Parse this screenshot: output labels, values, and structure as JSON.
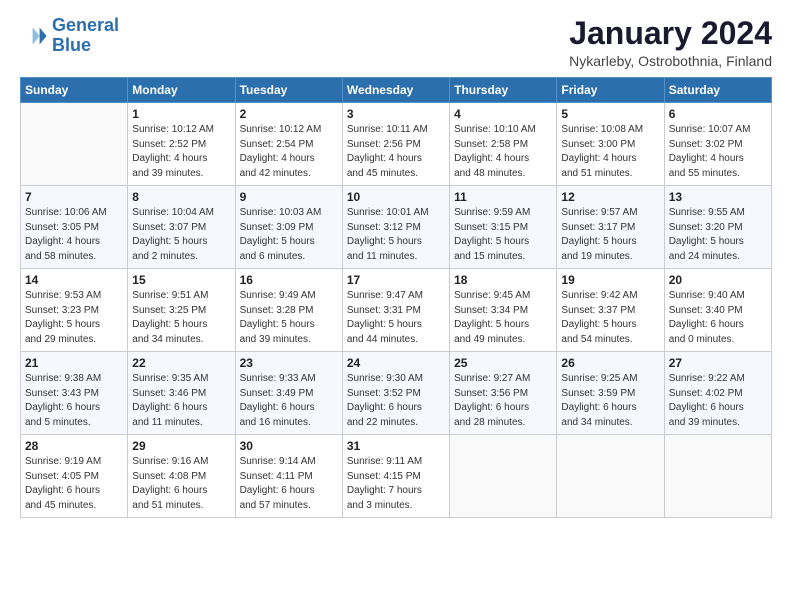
{
  "logo": {
    "line1": "General",
    "line2": "Blue"
  },
  "title": "January 2024",
  "subtitle": "Nykarleby, Ostrobothnia, Finland",
  "weekdays": [
    "Sunday",
    "Monday",
    "Tuesday",
    "Wednesday",
    "Thursday",
    "Friday",
    "Saturday"
  ],
  "weeks": [
    [
      {
        "day": "",
        "sunrise": "",
        "sunset": "",
        "daylight": ""
      },
      {
        "day": "1",
        "sunrise": "Sunrise: 10:12 AM",
        "sunset": "Sunset: 2:52 PM",
        "daylight": "Daylight: 4 hours and 39 minutes."
      },
      {
        "day": "2",
        "sunrise": "Sunrise: 10:12 AM",
        "sunset": "Sunset: 2:54 PM",
        "daylight": "Daylight: 4 hours and 42 minutes."
      },
      {
        "day": "3",
        "sunrise": "Sunrise: 10:11 AM",
        "sunset": "Sunset: 2:56 PM",
        "daylight": "Daylight: 4 hours and 45 minutes."
      },
      {
        "day": "4",
        "sunrise": "Sunrise: 10:10 AM",
        "sunset": "Sunset: 2:58 PM",
        "daylight": "Daylight: 4 hours and 48 minutes."
      },
      {
        "day": "5",
        "sunrise": "Sunrise: 10:08 AM",
        "sunset": "Sunset: 3:00 PM",
        "daylight": "Daylight: 4 hours and 51 minutes."
      },
      {
        "day": "6",
        "sunrise": "Sunrise: 10:07 AM",
        "sunset": "Sunset: 3:02 PM",
        "daylight": "Daylight: 4 hours and 55 minutes."
      }
    ],
    [
      {
        "day": "7",
        "sunrise": "Sunrise: 10:06 AM",
        "sunset": "Sunset: 3:05 PM",
        "daylight": "Daylight: 4 hours and 58 minutes."
      },
      {
        "day": "8",
        "sunrise": "Sunrise: 10:04 AM",
        "sunset": "Sunset: 3:07 PM",
        "daylight": "Daylight: 5 hours and 2 minutes."
      },
      {
        "day": "9",
        "sunrise": "Sunrise: 10:03 AM",
        "sunset": "Sunset: 3:09 PM",
        "daylight": "Daylight: 5 hours and 6 minutes."
      },
      {
        "day": "10",
        "sunrise": "Sunrise: 10:01 AM",
        "sunset": "Sunset: 3:12 PM",
        "daylight": "Daylight: 5 hours and 11 minutes."
      },
      {
        "day": "11",
        "sunrise": "Sunrise: 9:59 AM",
        "sunset": "Sunset: 3:15 PM",
        "daylight": "Daylight: 5 hours and 15 minutes."
      },
      {
        "day": "12",
        "sunrise": "Sunrise: 9:57 AM",
        "sunset": "Sunset: 3:17 PM",
        "daylight": "Daylight: 5 hours and 19 minutes."
      },
      {
        "day": "13",
        "sunrise": "Sunrise: 9:55 AM",
        "sunset": "Sunset: 3:20 PM",
        "daylight": "Daylight: 5 hours and 24 minutes."
      }
    ],
    [
      {
        "day": "14",
        "sunrise": "Sunrise: 9:53 AM",
        "sunset": "Sunset: 3:23 PM",
        "daylight": "Daylight: 5 hours and 29 minutes."
      },
      {
        "day": "15",
        "sunrise": "Sunrise: 9:51 AM",
        "sunset": "Sunset: 3:25 PM",
        "daylight": "Daylight: 5 hours and 34 minutes."
      },
      {
        "day": "16",
        "sunrise": "Sunrise: 9:49 AM",
        "sunset": "Sunset: 3:28 PM",
        "daylight": "Daylight: 5 hours and 39 minutes."
      },
      {
        "day": "17",
        "sunrise": "Sunrise: 9:47 AM",
        "sunset": "Sunset: 3:31 PM",
        "daylight": "Daylight: 5 hours and 44 minutes."
      },
      {
        "day": "18",
        "sunrise": "Sunrise: 9:45 AM",
        "sunset": "Sunset: 3:34 PM",
        "daylight": "Daylight: 5 hours and 49 minutes."
      },
      {
        "day": "19",
        "sunrise": "Sunrise: 9:42 AM",
        "sunset": "Sunset: 3:37 PM",
        "daylight": "Daylight: 5 hours and 54 minutes."
      },
      {
        "day": "20",
        "sunrise": "Sunrise: 9:40 AM",
        "sunset": "Sunset: 3:40 PM",
        "daylight": "Daylight: 6 hours and 0 minutes."
      }
    ],
    [
      {
        "day": "21",
        "sunrise": "Sunrise: 9:38 AM",
        "sunset": "Sunset: 3:43 PM",
        "daylight": "Daylight: 6 hours and 5 minutes."
      },
      {
        "day": "22",
        "sunrise": "Sunrise: 9:35 AM",
        "sunset": "Sunset: 3:46 PM",
        "daylight": "Daylight: 6 hours and 11 minutes."
      },
      {
        "day": "23",
        "sunrise": "Sunrise: 9:33 AM",
        "sunset": "Sunset: 3:49 PM",
        "daylight": "Daylight: 6 hours and 16 minutes."
      },
      {
        "day": "24",
        "sunrise": "Sunrise: 9:30 AM",
        "sunset": "Sunset: 3:52 PM",
        "daylight": "Daylight: 6 hours and 22 minutes."
      },
      {
        "day": "25",
        "sunrise": "Sunrise: 9:27 AM",
        "sunset": "Sunset: 3:56 PM",
        "daylight": "Daylight: 6 hours and 28 minutes."
      },
      {
        "day": "26",
        "sunrise": "Sunrise: 9:25 AM",
        "sunset": "Sunset: 3:59 PM",
        "daylight": "Daylight: 6 hours and 34 minutes."
      },
      {
        "day": "27",
        "sunrise": "Sunrise: 9:22 AM",
        "sunset": "Sunset: 4:02 PM",
        "daylight": "Daylight: 6 hours and 39 minutes."
      }
    ],
    [
      {
        "day": "28",
        "sunrise": "Sunrise: 9:19 AM",
        "sunset": "Sunset: 4:05 PM",
        "daylight": "Daylight: 6 hours and 45 minutes."
      },
      {
        "day": "29",
        "sunrise": "Sunrise: 9:16 AM",
        "sunset": "Sunset: 4:08 PM",
        "daylight": "Daylight: 6 hours and 51 minutes."
      },
      {
        "day": "30",
        "sunrise": "Sunrise: 9:14 AM",
        "sunset": "Sunset: 4:11 PM",
        "daylight": "Daylight: 6 hours and 57 minutes."
      },
      {
        "day": "31",
        "sunrise": "Sunrise: 9:11 AM",
        "sunset": "Sunset: 4:15 PM",
        "daylight": "Daylight: 7 hours and 3 minutes."
      },
      {
        "day": "",
        "sunrise": "",
        "sunset": "",
        "daylight": ""
      },
      {
        "day": "",
        "sunrise": "",
        "sunset": "",
        "daylight": ""
      },
      {
        "day": "",
        "sunrise": "",
        "sunset": "",
        "daylight": ""
      }
    ]
  ]
}
